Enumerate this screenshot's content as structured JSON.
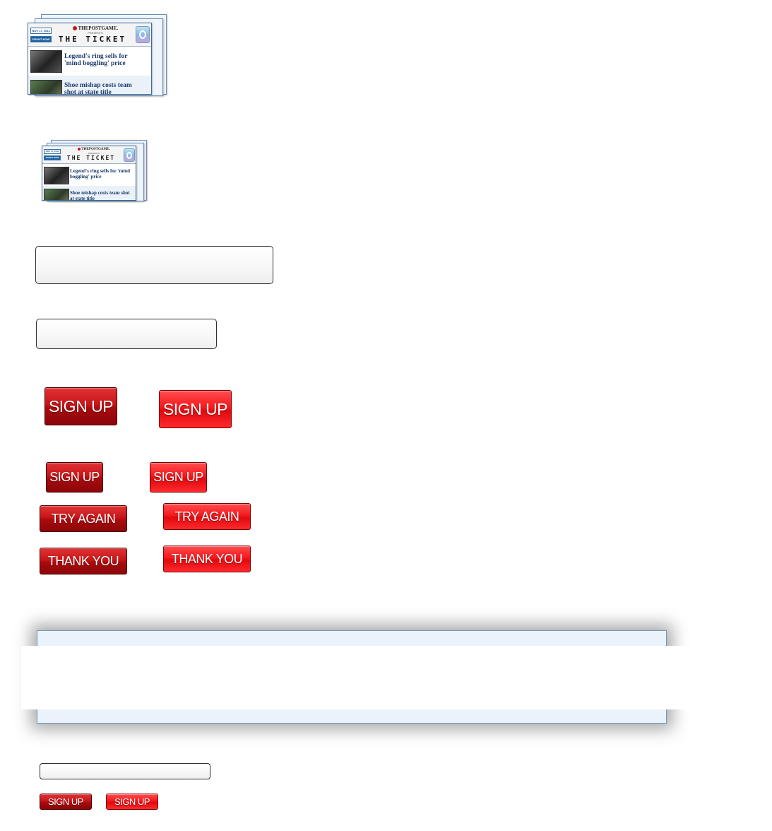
{
  "newsletter": {
    "date": "NOV 17, 2011",
    "front_label": "FRONT NOW",
    "brand": "THEPOSTGAME.",
    "presents": "PRESENTS",
    "title": "THE TICKET",
    "headlines": [
      "Legend's ring sells for 'mind boggling' price",
      "Shoe mishap costs team shot at state title"
    ]
  },
  "buttons": {
    "sign_up": "SIGN UP",
    "try_again": "TRY AGAIN",
    "thank_you": "THANK YOU"
  },
  "colors": {
    "button_dark": "#b00d10",
    "button_bright": "#f0141a",
    "panel_background": "#eaf3fb",
    "headline_text": "#1b3a6b"
  }
}
